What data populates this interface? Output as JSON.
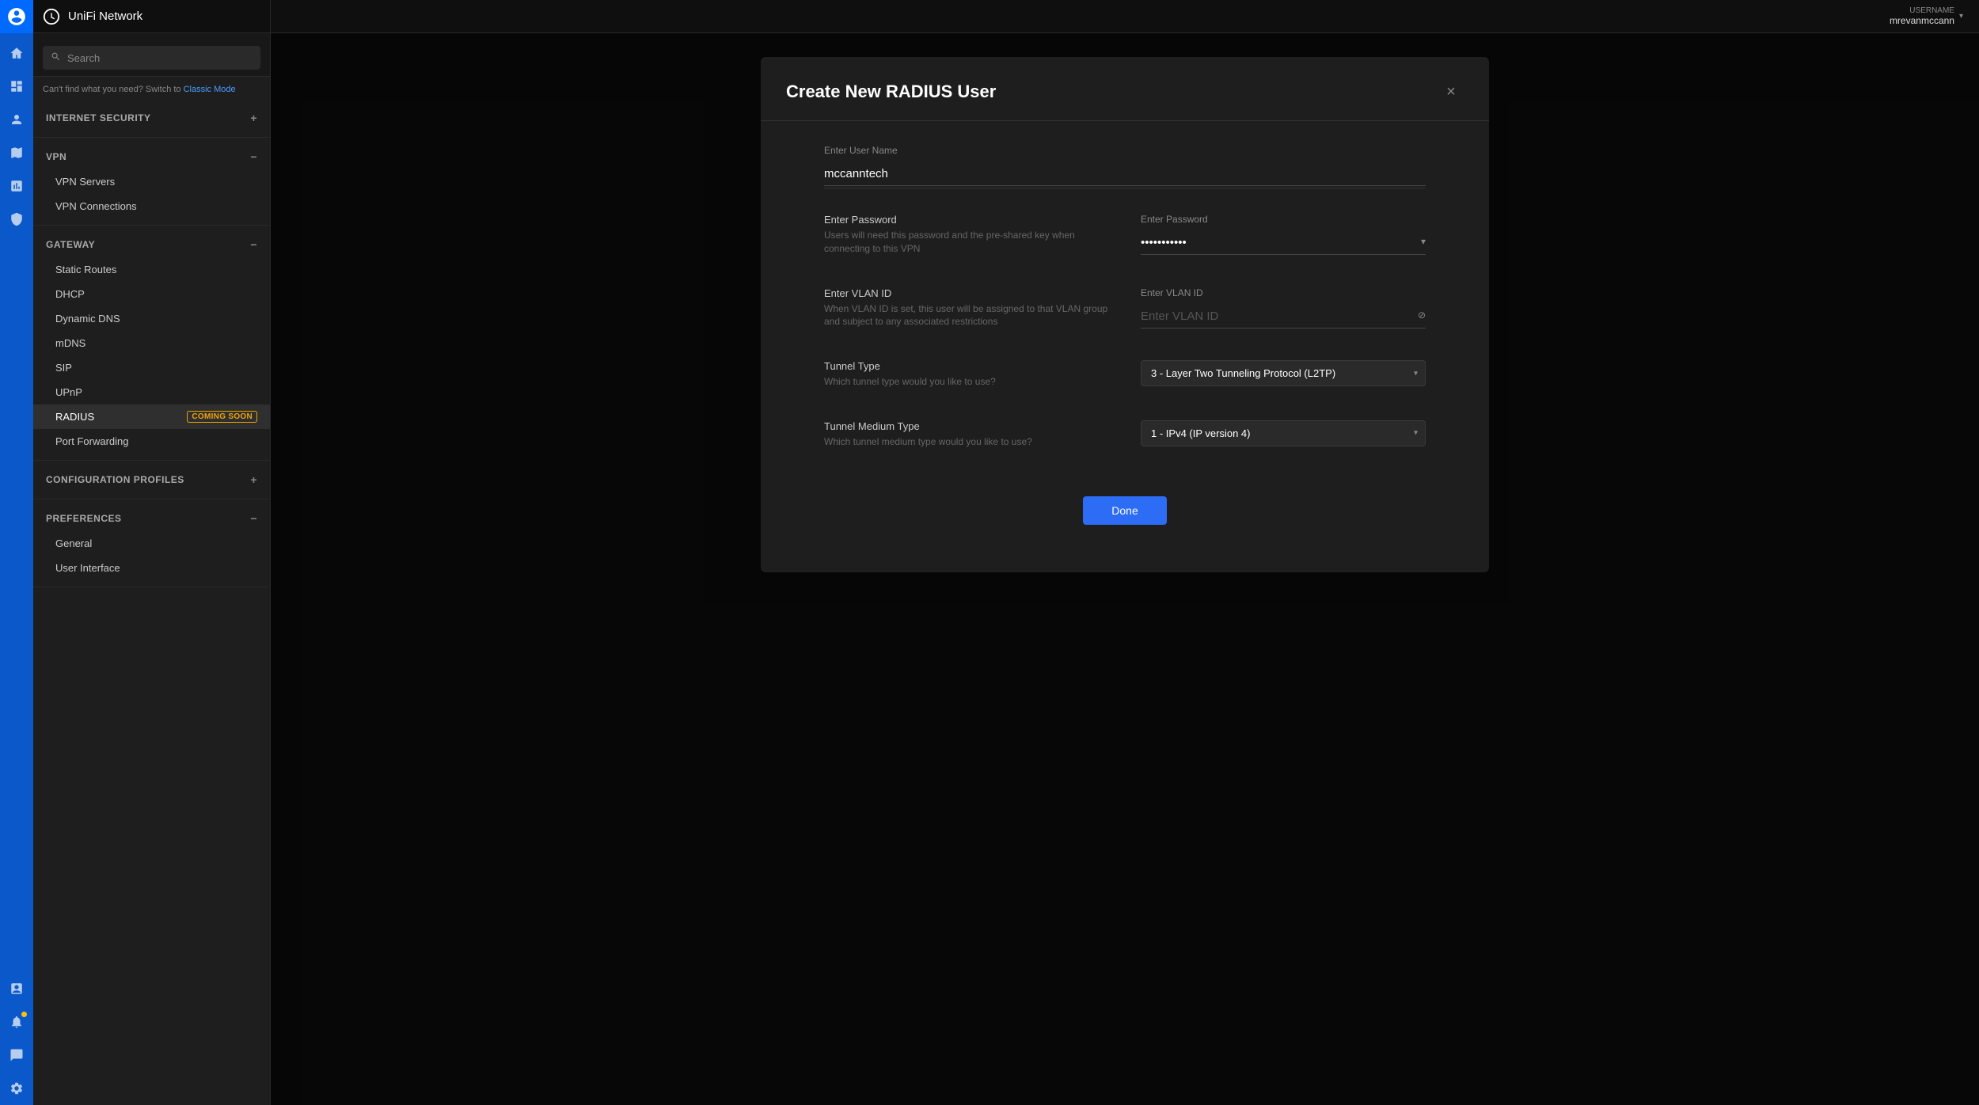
{
  "app": {
    "title": "UniFi Network",
    "logo_alt": "UniFi Logo"
  },
  "header": {
    "username_label": "USERNAME",
    "username": "mrevanmccann",
    "chevron": "▾"
  },
  "sidebar": {
    "search_placeholder": "Search",
    "classic_mode_text": "Can't find what you need? Switch to ",
    "classic_mode_link": "Classic Mode",
    "sections": [
      {
        "id": "internet_security",
        "label": "INTERNET SECURITY",
        "expanded": false,
        "toggle": "+"
      },
      {
        "id": "vpn",
        "label": "VPN",
        "expanded": true,
        "toggle": "−",
        "items": [
          {
            "id": "vpn_servers",
            "label": "VPN Servers"
          },
          {
            "id": "vpn_connections",
            "label": "VPN Connections"
          }
        ]
      },
      {
        "id": "gateway",
        "label": "GATEWAY",
        "expanded": true,
        "toggle": "−",
        "items": [
          {
            "id": "static_routes",
            "label": "Static Routes"
          },
          {
            "id": "dhcp",
            "label": "DHCP"
          },
          {
            "id": "dynamic_dns",
            "label": "Dynamic DNS"
          },
          {
            "id": "mdns",
            "label": "mDNS"
          },
          {
            "id": "sip",
            "label": "SIP"
          },
          {
            "id": "upnp",
            "label": "UPnP"
          },
          {
            "id": "radius",
            "label": "RADIUS",
            "badge": "COMING SOON",
            "active": true
          },
          {
            "id": "port_forwarding",
            "label": "Port Forwarding"
          }
        ]
      },
      {
        "id": "config_profiles",
        "label": "CONFIGURATION PROFILES",
        "expanded": false,
        "toggle": "+"
      },
      {
        "id": "preferences",
        "label": "PREFERENCES",
        "expanded": true,
        "toggle": "−",
        "items": [
          {
            "id": "general",
            "label": "General"
          },
          {
            "id": "user_interface",
            "label": "User Interface"
          }
        ]
      }
    ]
  },
  "modal": {
    "title": "Create New RADIUS User",
    "close_label": "×",
    "fields": {
      "username": {
        "label": "Enter User Name",
        "value": "mccanntech"
      },
      "password": {
        "label": "Enter Password",
        "hint": "Users will need this password and the pre-shared key when connecting to this VPN",
        "placeholder": "Enter Password",
        "masked_value": "●●●●●●●●●●●●"
      },
      "vlan_id": {
        "label": "Enter VLAN ID",
        "hint": "When VLAN ID is set, this user will be assigned to that VLAN group and subject to any associated restrictions",
        "placeholder": "Enter VLAN ID",
        "value": ""
      },
      "tunnel_type": {
        "label": "Tunnel Type",
        "hint": "Which tunnel type would you like to use?",
        "selected": "3 - Layer Two Tunneling Protocol (L2TP)",
        "options": [
          "3 - Layer Two Tunneling Protocol (L2TP)"
        ]
      },
      "tunnel_medium_type": {
        "label": "Tunnel Medium Type",
        "hint": "Which tunnel medium type would you like to use?",
        "selected": "1 - IPv4 (IP version 4)",
        "options": [
          "1 - IPv4 (IP version 4)"
        ]
      }
    },
    "done_button": "Done"
  },
  "rail_icons": [
    {
      "id": "home",
      "symbol": "○"
    },
    {
      "id": "dashboard",
      "symbol": "▦"
    },
    {
      "id": "clients",
      "symbol": "◉"
    },
    {
      "id": "map",
      "symbol": "⬡"
    },
    {
      "id": "stats",
      "symbol": "⬛"
    },
    {
      "id": "alerts",
      "symbol": "◎"
    },
    {
      "id": "devices",
      "symbol": "◈"
    },
    {
      "id": "profiles",
      "symbol": "☆"
    },
    {
      "id": "notifications",
      "symbol": "🔔",
      "badge": true
    },
    {
      "id": "messages",
      "symbol": "💬"
    },
    {
      "id": "settings",
      "symbol": "⚙"
    }
  ]
}
